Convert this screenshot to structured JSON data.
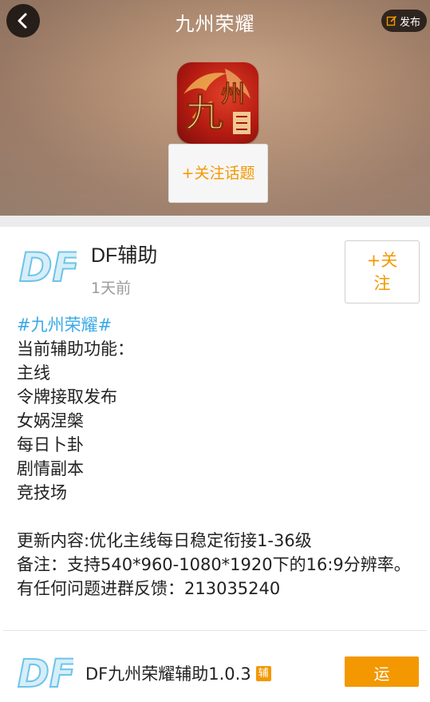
{
  "header": {
    "title": "九州荣耀",
    "publish_label": "发布",
    "follow_topic_label": "+关注话题",
    "icons": {
      "back": "back-arrow-icon",
      "publish": "edit-icon",
      "app": "game-app-icon"
    }
  },
  "post": {
    "author": "DF辅助",
    "time": "1天前",
    "follow_label": "+关注",
    "hashtag": "#九州荣耀#",
    "content_lines": [
      "当前辅助功能：",
      "主线",
      "令牌接取发布",
      "女娲涅槃",
      "每日卜卦",
      "剧情副本",
      "竞技场",
      "",
      "更新内容:优化主线每日稳定衔接1-36级",
      "备注：支持540*960-1080*1920下的16:9分辨率。",
      "有任何问题进群反馈：213035240"
    ]
  },
  "app_card": {
    "name": "DF九州荣耀辅助1.0.3",
    "badge": "辅",
    "action_label": "运"
  },
  "colors": {
    "accent": "#f39800",
    "hashtag": "#3aa9e6",
    "text": "#222222",
    "muted": "#9a9a9a"
  }
}
